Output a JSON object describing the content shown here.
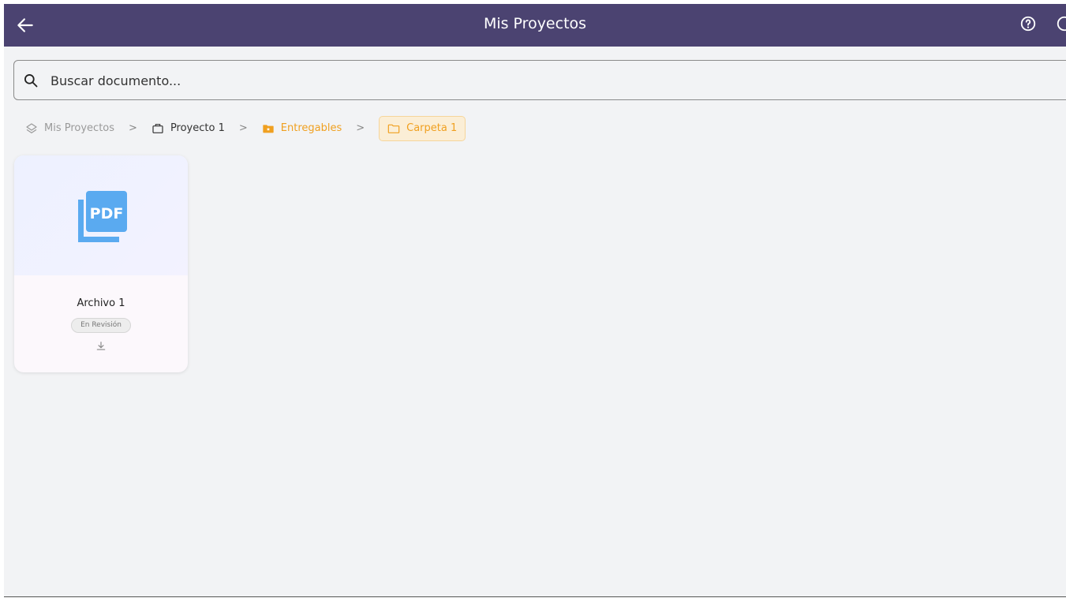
{
  "appbar": {
    "title": "Mis Proyectos",
    "back_icon": "arrow-left-icon",
    "help_icon": "help-circle-icon",
    "more_icon": "circle-icon"
  },
  "search": {
    "placeholder": "Buscar documento...",
    "value": ""
  },
  "breadcrumb": [
    {
      "label": "Mis Proyectos",
      "icon": "layers-icon"
    },
    {
      "label": "Proyecto 1",
      "icon": "briefcase-icon"
    },
    {
      "label": "Entregables",
      "icon": "folder-star-icon"
    },
    {
      "label": "Carpeta 1",
      "icon": "folder-icon"
    }
  ],
  "separator": ">",
  "files": [
    {
      "name": "Archivo 1",
      "status": "En Revisión",
      "type": "PDF"
    }
  ],
  "colors": {
    "appbar": "#4b4371",
    "accent": "#f0a020",
    "pdf": "#5aaaf0"
  }
}
